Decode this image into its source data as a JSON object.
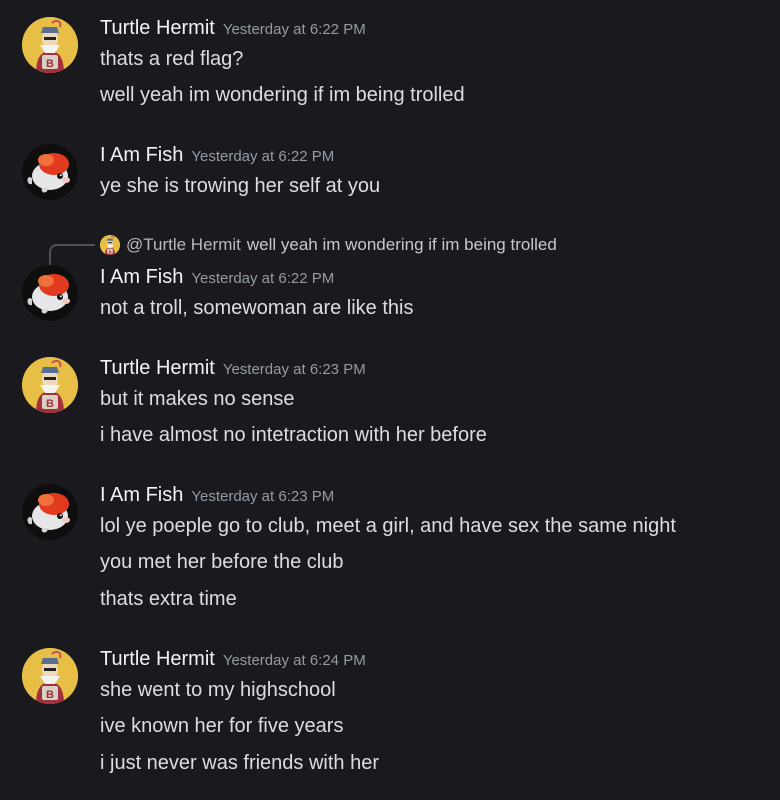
{
  "messages": [
    {
      "author": "Turtle Hermit",
      "timestamp": "Yesterday at 6:22 PM",
      "lines": [
        "thats a red flag?",
        "well yeah im wondering if im being trolled"
      ]
    },
    {
      "author": "I Am Fish",
      "timestamp": "Yesterday at 6:22 PM",
      "lines": [
        "ye she is trowing her self at you"
      ]
    },
    {
      "reply": {
        "user": "@Turtle Hermit",
        "text": "well yeah im wondering if im being trolled"
      },
      "author": "I Am Fish",
      "timestamp": "Yesterday at 6:22 PM",
      "lines": [
        "not a troll, somewoman are like this"
      ]
    },
    {
      "author": "Turtle Hermit",
      "timestamp": "Yesterday at 6:23 PM",
      "lines": [
        "but it makes no sense",
        "i have almost no intetraction with her before"
      ]
    },
    {
      "author": "I Am Fish",
      "timestamp": "Yesterday at 6:23 PM",
      "lines": [
        "lol ye poeple go to club, meet a girl, and have sex the same night",
        "you met her before the club",
        "thats extra time"
      ]
    },
    {
      "author": "Turtle Hermit",
      "timestamp": "Yesterday at 6:24 PM",
      "lines": [
        "she went to my highschool",
        "ive known her for five years",
        "i just never was friends with her"
      ]
    }
  ],
  "colors": {
    "background": "#1a1a1e",
    "username": "#f2f3f5",
    "timestamp": "#949ba4",
    "text": "#dbdee1"
  },
  "avatars": {
    "turtle_hermit": "turtle-hermit-avatar-icon",
    "i_am_fish": "goldfish-avatar-icon"
  }
}
